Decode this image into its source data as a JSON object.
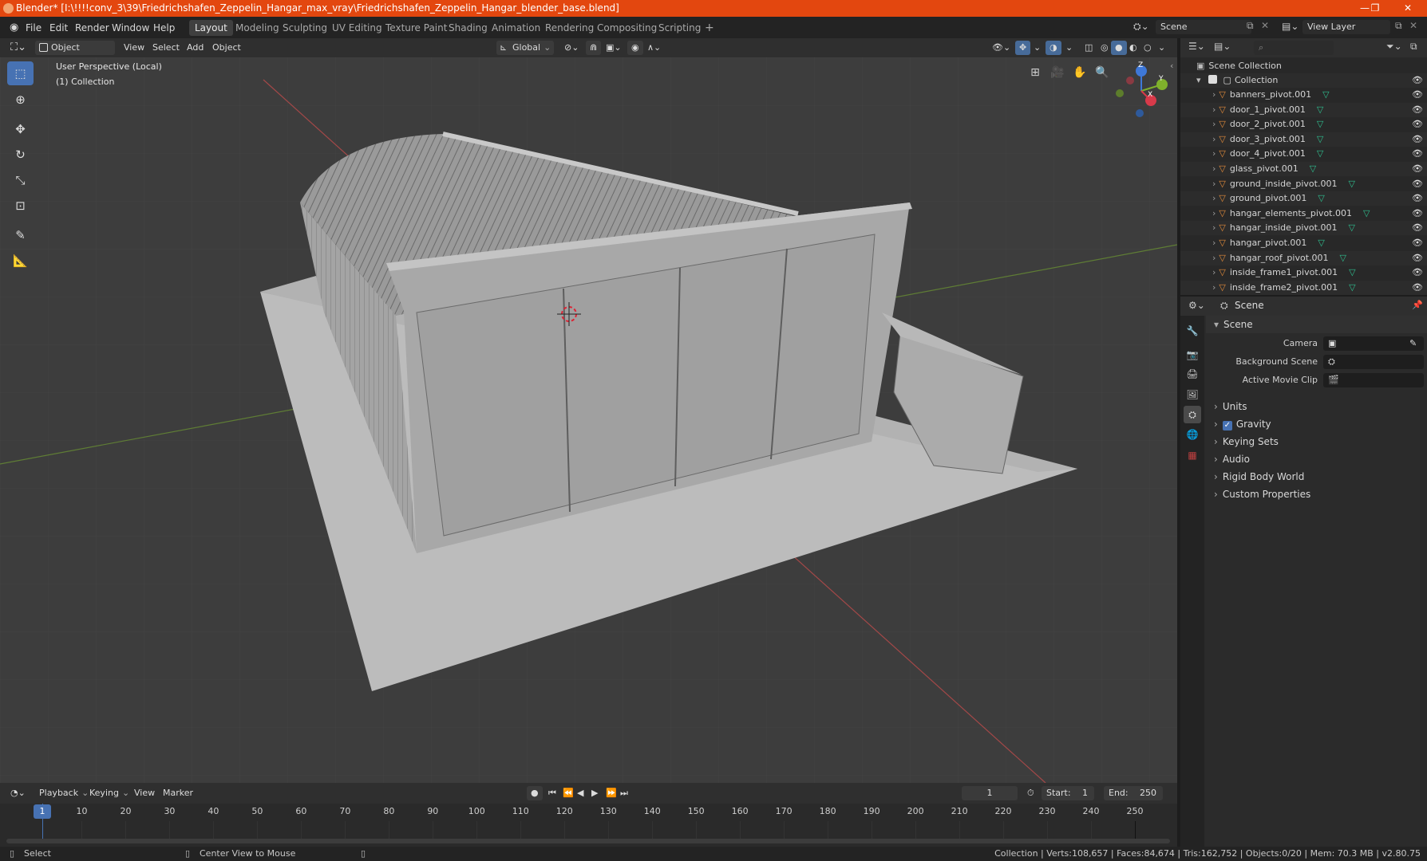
{
  "window": {
    "title": "Blender* [I:\\!!!!conv_3\\39\\Friedrichshafen_Zeppelin_Hangar_max_vray\\Friedrichshafen_Zeppelin_Hangar_blender_base.blend]",
    "minimize": "—",
    "maximize": "❐",
    "close": "✕"
  },
  "menu": {
    "items": [
      "File",
      "Edit",
      "Render",
      "Window",
      "Help"
    ],
    "workspaces": [
      "Layout",
      "Modeling",
      "Sculpting",
      "UV Editing",
      "Texture Paint",
      "Shading",
      "Animation",
      "Rendering",
      "Compositing",
      "Scripting"
    ],
    "add_workspace": "+",
    "scene_label": "Scene",
    "view_layer_label": "View Layer"
  },
  "viewport_header": {
    "mode": "Object Mode",
    "menus": [
      "View",
      "Select",
      "Add",
      "Object"
    ],
    "orientation": "Global"
  },
  "viewport": {
    "perspective": "User Perspective (Local)",
    "collection": "(1) Collection",
    "gizmo": {
      "z": "Z",
      "y": "Y",
      "x": "X"
    }
  },
  "outliner": {
    "root": "Scene Collection",
    "collection": "Collection",
    "items": [
      "banners_pivot.001",
      "door_1_pivot.001",
      "door_2_pivot.001",
      "door_3_pivot.001",
      "door_4_pivot.001",
      "glass_pivot.001",
      "ground_inside_pivot.001",
      "ground_pivot.001",
      "hangar_elements_pivot.001",
      "hangar_inside_pivot.001",
      "hangar_pivot.001",
      "hangar_roof_pivot.001",
      "inside_frame1_pivot.001",
      "inside_frame2_pivot.001"
    ]
  },
  "properties": {
    "context": "Scene",
    "panel": "Scene",
    "camera_label": "Camera",
    "background_scene_label": "Background Scene",
    "active_movie_clip_label": "Active Movie Clip",
    "sections": [
      "Units",
      "Gravity",
      "Keying Sets",
      "Audio",
      "Rigid Body World",
      "Custom Properties"
    ],
    "gravity_checked": true
  },
  "timeline": {
    "menus": [
      "Playback",
      "Keying",
      "View",
      "Marker"
    ],
    "current_frame": "1",
    "start_label": "Start:",
    "start": "1",
    "end_label": "End:",
    "end": "250",
    "ticks": [
      "1",
      "10",
      "20",
      "30",
      "40",
      "50",
      "60",
      "70",
      "80",
      "90",
      "100",
      "110",
      "120",
      "130",
      "140",
      "150",
      "160",
      "170",
      "180",
      "190",
      "200",
      "210",
      "220",
      "230",
      "240",
      "250"
    ]
  },
  "status": {
    "left": "Select",
    "middle": "Center View to Mouse",
    "right": "Collection | Verts:108,657 | Faces:84,674 | Tris:162,752 | Objects:0/20 | Mem: 70.3 MB | v2.80.75"
  },
  "colors": {
    "accent": "#4772b3",
    "titlebar": "#e3470f",
    "mesh_icon": "#e08a3a",
    "data_icon": "#2fbf8f",
    "x_axis": "#d83a4a",
    "y_axis": "#7fb02c",
    "z_axis": "#3e78d8"
  }
}
